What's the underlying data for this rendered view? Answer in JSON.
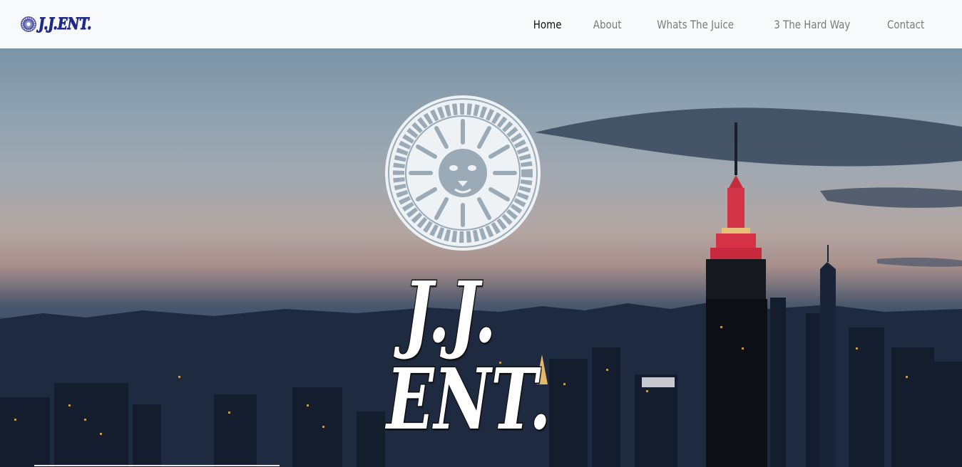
{
  "brand": {
    "logo_text": "J.J.ENT.",
    "emblem_icon": "lion-medallion-icon",
    "color": "#1e2a8a"
  },
  "nav": {
    "items": [
      {
        "label": "Home",
        "active": true
      },
      {
        "label": "About",
        "active": false
      },
      {
        "label": "Whats The Juice",
        "active": false
      },
      {
        "label": "3 The Hard Way",
        "active": false
      },
      {
        "label": "Contact",
        "active": false
      }
    ]
  },
  "hero": {
    "emblem_icon": "lion-medallion-icon",
    "title_line1": "J.J.",
    "title_line2": "ENT.",
    "background": "city-skyline-dusk"
  },
  "colors": {
    "navbar_bg": "#f8f9fa",
    "nav_link": "#7b7b7b",
    "nav_link_active": "#111111",
    "building_accent": "#e0344a"
  }
}
